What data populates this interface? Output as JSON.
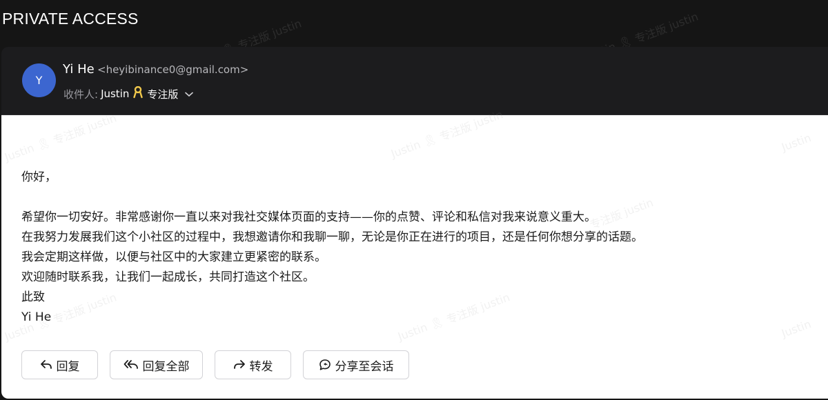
{
  "page": {
    "title": "PRIVATE ACCESS"
  },
  "email": {
    "sender": {
      "avatar_initial": "Y",
      "name": "Yi He",
      "email": "<heyibinance0@gmail.com>"
    },
    "recipient": {
      "label": "收件人:",
      "name": "Justin",
      "badge_icon": "ribbon-icon",
      "plan": "专注版"
    },
    "body": {
      "greeting": "你好，",
      "lines": [
        "希望你一切安好。非常感谢你一直以来对我社交媒体页面的支持——你的点赞、评论和私信对我来说意义重大。",
        "在我努力发展我们这个小社区的过程中，我想邀请你和我聊一聊，无论是你正在进行的项目，还是任何你想分享的话题。",
        "我会定期这样做，以便与社区中的大家建立更紧密的联系。",
        "欢迎随时联系我，让我们一起成长，共同打造这个社区。"
      ],
      "closing": "此致",
      "signature": "Yi He"
    },
    "actions": {
      "reply": "回复",
      "reply_all": "回复全部",
      "forward": "转发",
      "share": "分享至会话"
    }
  },
  "watermark": {
    "name": "Justin",
    "plan": "专注版",
    "suffix": "justin"
  },
  "colors": {
    "background": "#151515",
    "header": "#1c1c1e",
    "avatar": "#3c66d0",
    "ribbon": "#f2c94c"
  }
}
